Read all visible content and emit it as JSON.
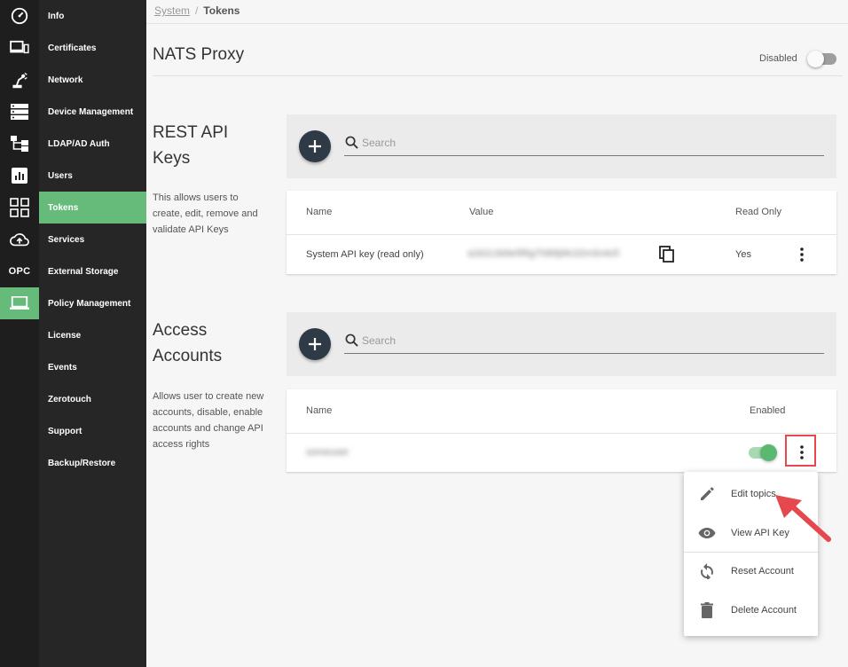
{
  "sidebar": {
    "items": [
      {
        "label": "Info",
        "icon": "dashboard-gauge-icon"
      },
      {
        "label": "Certificates",
        "icon": "devices-icon"
      },
      {
        "label": "Network",
        "icon": "robot-arm-icon"
      },
      {
        "label": "Device Management",
        "icon": "server-icon"
      },
      {
        "label": "LDAP/AD Auth",
        "icon": "sitemap-icon"
      },
      {
        "label": "Users",
        "icon": "chart-box-icon"
      },
      {
        "label": "Tokens",
        "icon": "grid-icon",
        "active": true
      },
      {
        "label": "Services",
        "icon": "cloud-upload-icon"
      },
      {
        "label": "External Storage",
        "icon": "opc-text-icon",
        "icon_text": "OPC"
      },
      {
        "label": "Policy Management",
        "icon": "laptop-icon"
      },
      {
        "label": "License"
      },
      {
        "label": "Events"
      },
      {
        "label": "Zerotouch"
      },
      {
        "label": "Support"
      },
      {
        "label": "Backup/Restore"
      }
    ],
    "active_color": "#66bb7a"
  },
  "breadcrumb": {
    "parent": "System",
    "separator": "/",
    "current": "Tokens"
  },
  "page": {
    "title": "NATS Proxy",
    "toggle_label": "Disabled",
    "toggle_on": false
  },
  "rest_api": {
    "heading_line1": "REST API",
    "heading_line2": "Keys",
    "description": "This allows users to create, edit, remove and validate API Keys",
    "search_placeholder": "Search",
    "columns": {
      "name": "Name",
      "value": "Value",
      "read_only": "Read Only"
    },
    "rows": [
      {
        "name": "System API key (read only)",
        "value": "a1b2c3d4e5f6g7h8i9j0k1l2m3n4o5",
        "read_only": "Yes"
      }
    ]
  },
  "access_accounts": {
    "heading_line1": "Access",
    "heading_line2": "Accounts",
    "description": "Allows user to create new accounts, disable, enable accounts and change API access rights",
    "search_placeholder": "Search",
    "columns": {
      "name": "Name",
      "enabled": "Enabled"
    },
    "rows": [
      {
        "name": "someuser",
        "enabled": true
      }
    ]
  },
  "context_menu": {
    "items": [
      {
        "label": "Edit topics",
        "icon": "pencil-icon"
      },
      {
        "label": "View API Key",
        "icon": "eye-icon"
      },
      {
        "label": "Reset Account",
        "icon": "refresh-icon"
      },
      {
        "label": "Delete Account",
        "icon": "trash-icon"
      }
    ]
  },
  "colors": {
    "accent": "#66bb7a",
    "fab": "#2e3a46",
    "highlight": "#e5484d"
  }
}
